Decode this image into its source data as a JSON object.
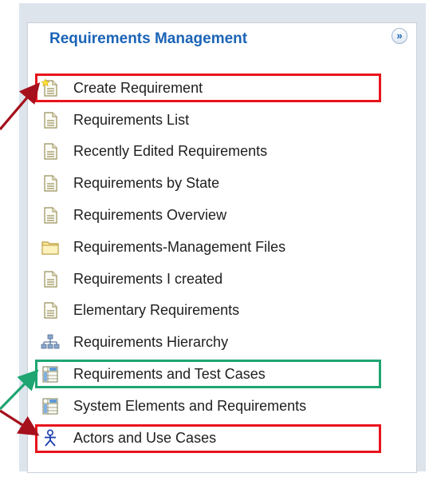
{
  "panel": {
    "title": "Requirements Management",
    "collapse_icon": "chevron-up-double-icon",
    "items": [
      {
        "label": "Create Requirement",
        "icon": "new-document-icon"
      },
      {
        "label": "Requirements List",
        "icon": "document-icon"
      },
      {
        "label": "Recently Edited Requirements",
        "icon": "document-icon"
      },
      {
        "label": "Requirements by State",
        "icon": "document-icon"
      },
      {
        "label": "Requirements Overview",
        "icon": "document-icon"
      },
      {
        "label": "Requirements-Management Files",
        "icon": "folder-icon"
      },
      {
        "label": "Requirements I created",
        "icon": "document-icon"
      },
      {
        "label": "Elementary Requirements",
        "icon": "document-icon"
      },
      {
        "label": "Requirements Hierarchy",
        "icon": "hierarchy-icon"
      },
      {
        "label": "Requirements and Test Cases",
        "icon": "matrix-icon"
      },
      {
        "label": "System Elements and Requirements",
        "icon": "matrix-icon"
      },
      {
        "label": "Actors and Use Cases",
        "icon": "actor-icon"
      }
    ]
  },
  "highlights": [
    {
      "item": "Create Requirement",
      "color": "#e8141c"
    },
    {
      "item": "Requirements and Test Cases",
      "color": "#1fa572"
    },
    {
      "item": "Actors and Use Cases",
      "color": "#e8141c"
    }
  ],
  "arrow_colors": [
    "#a5101c",
    "#1fa572"
  ]
}
